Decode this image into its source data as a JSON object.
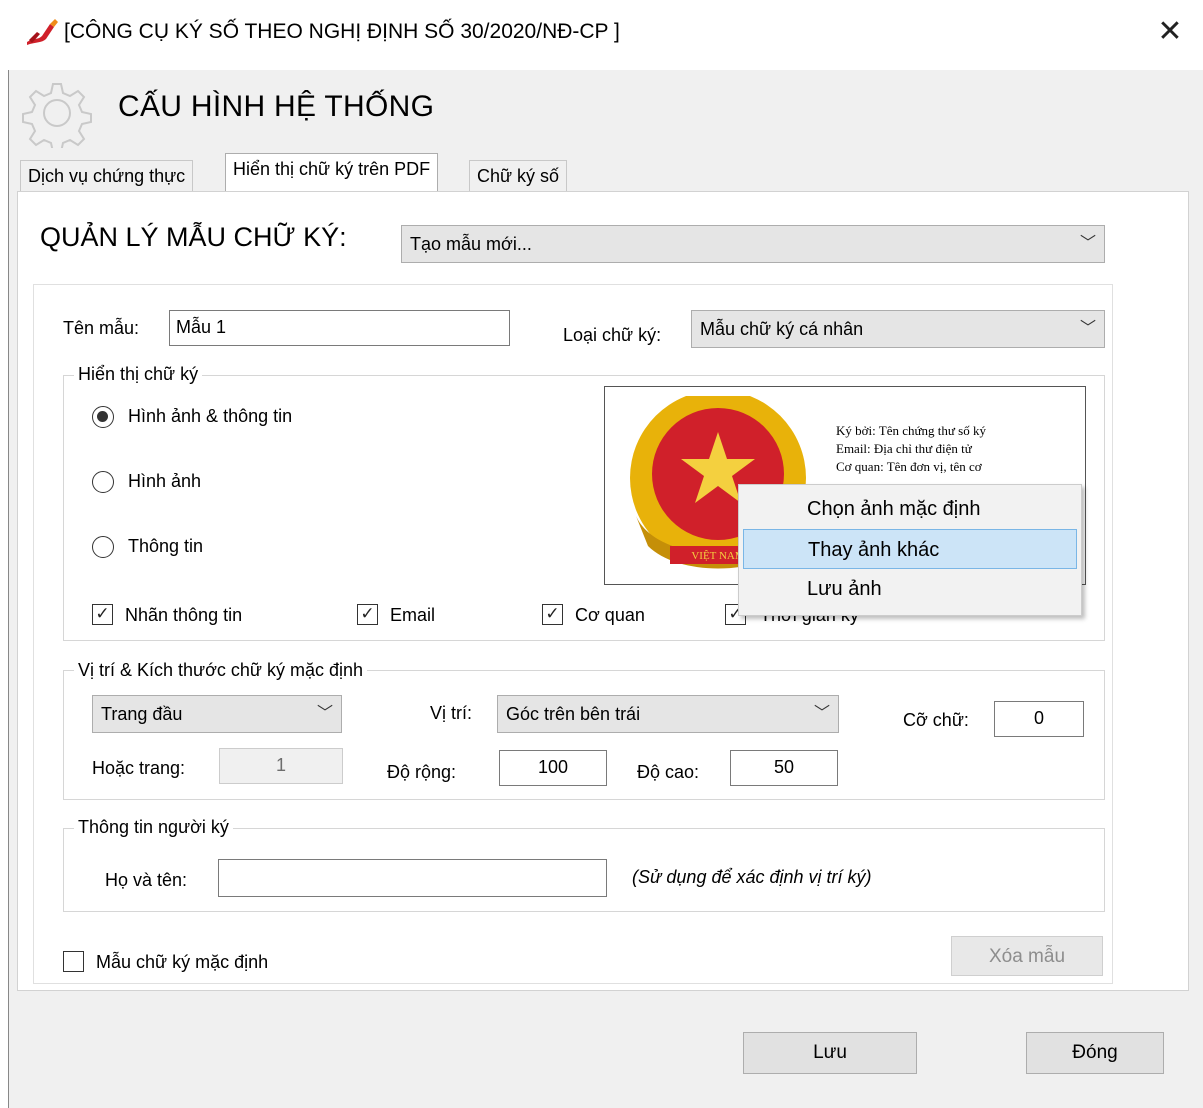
{
  "window": {
    "title": "[CÔNG CỤ KÝ SỐ THEO NGHỊ ĐỊNH SỐ 30/2020/NĐ-CP ]",
    "close_glyph": "✕",
    "header_title": "CẤU HÌNH HỆ THỐNG",
    "app_icon": "pen-icon",
    "header_icon": "gear-icon"
  },
  "tabs": [
    {
      "label": "Dịch vụ chứng thực"
    },
    {
      "label": "Hiển thị chữ ký trên PDF"
    },
    {
      "label": "Chữ ký số"
    }
  ],
  "template_manager": {
    "label": "QUẢN LÝ MẪU CHỮ KÝ:",
    "selected": "Tạo mẫu mới..."
  },
  "template": {
    "name_label": "Tên mẫu:",
    "name_value": "Mẫu 1",
    "type_label": "Loại chữ ký:",
    "type_value": "Mẫu chữ ký cá nhân"
  },
  "display": {
    "group_title": "Hiển thị chữ ký",
    "radio_options": [
      "Hình ảnh & thông tin",
      "Hình ảnh",
      "Thông tin"
    ],
    "checkboxes": [
      {
        "label": "Nhãn thông tin",
        "checked": true
      },
      {
        "label": "Email",
        "checked": true
      },
      {
        "label": "Cơ quan",
        "checked": true
      },
      {
        "label": "Thời gian ký",
        "checked": true
      }
    ],
    "check_glyph": "✓",
    "preview_lines": [
      "Ký bởi: Tên chứng thư số ký",
      "Email: Địa chỉ thư điện tử",
      "Cơ quan: Tên đơn vị, tên cơ"
    ],
    "emblem_text": "VIỆT NAM"
  },
  "context_menu": {
    "items": [
      "Chọn ảnh mặc định",
      "Thay ảnh khác",
      "Lưu ảnh"
    ]
  },
  "position": {
    "group_title": "Vị trí  & Kích thước chữ ký mặc định",
    "page_select": "Trang đầu",
    "position_label": "Vị trí:",
    "position_select": "Góc trên bên trái",
    "font_size_label": "Cỡ chữ:",
    "font_size_value": "0",
    "or_page_label": "Hoặc trang:",
    "or_page_value": "1",
    "width_label": "Độ rộng:",
    "width_value": "100",
    "height_label": "Độ cao:",
    "height_value": "50"
  },
  "signer": {
    "group_title": "Thông tin người ký",
    "name_label": "Họ và tên:",
    "name_value": "",
    "hint": "(Sử dụng để xác định vị trí ký)"
  },
  "default_template": {
    "label": "Mẫu chữ ký mặc định",
    "checked": false
  },
  "buttons": {
    "delete": "Xóa mẫu",
    "save": "Lưu",
    "close": "Đóng"
  },
  "colors": {
    "accent_red": "#d0202a",
    "emblem_gold": "#e8b20a",
    "highlight": "#cce4f7"
  }
}
